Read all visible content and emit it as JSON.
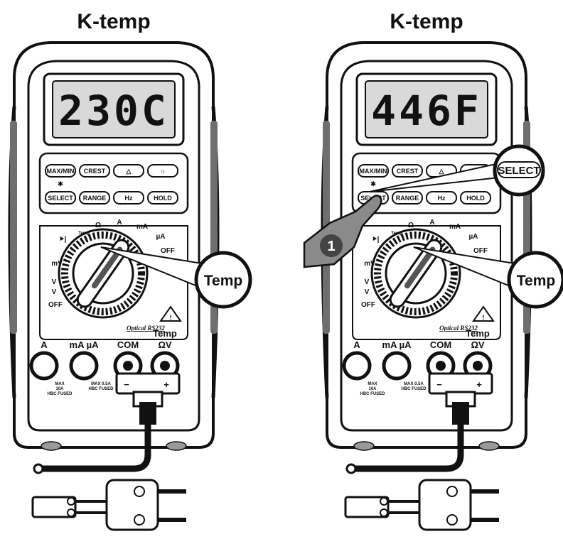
{
  "panels": [
    {
      "title": "K-temp",
      "display": "230C",
      "callout": "Temp",
      "show_select_callout": false
    },
    {
      "title": "K-temp",
      "display": "446F",
      "callout": "Temp",
      "show_select_callout": true,
      "select_callout": "SELECT",
      "step_number": "1"
    }
  ],
  "buttons": {
    "row1": [
      "MAX/MIN",
      "CREST",
      "△",
      "☼"
    ],
    "row2": [
      "SELECT",
      "RANGE",
      "Hz",
      "HOLD"
    ]
  },
  "dial_labels": {
    "diode": "⯈|",
    "temp": "Temp",
    "ohm": "Ω",
    "amp": "A",
    "milliamp": "mA",
    "microamp": "µA",
    "off_right": "OFF",
    "millivolt": "mV",
    "volt_dc": "V",
    "volt_ac": "V",
    "off_left": "OFF"
  },
  "optical_label": "Optical RS232",
  "warning_icon": "warning-triangle-icon",
  "jacks": {
    "a": "A",
    "ma_ua": "mA µA",
    "com": "COM",
    "temp": "Temp",
    "ohm_v": "ΩV"
  },
  "fuse_labels": {
    "left_line1": "MAX",
    "left_line2": "10A",
    "left_line3": "HBC FUSED",
    "right_line1": "MAX 0.5A",
    "right_line2": "HBC FUSED"
  },
  "adapter_polarity": {
    "minus": "−",
    "plus": "+"
  },
  "colors": {
    "outline": "#111111",
    "lcd": "#d9d9d9",
    "body": "#ffffff",
    "shadow": "#6e6e6e"
  }
}
